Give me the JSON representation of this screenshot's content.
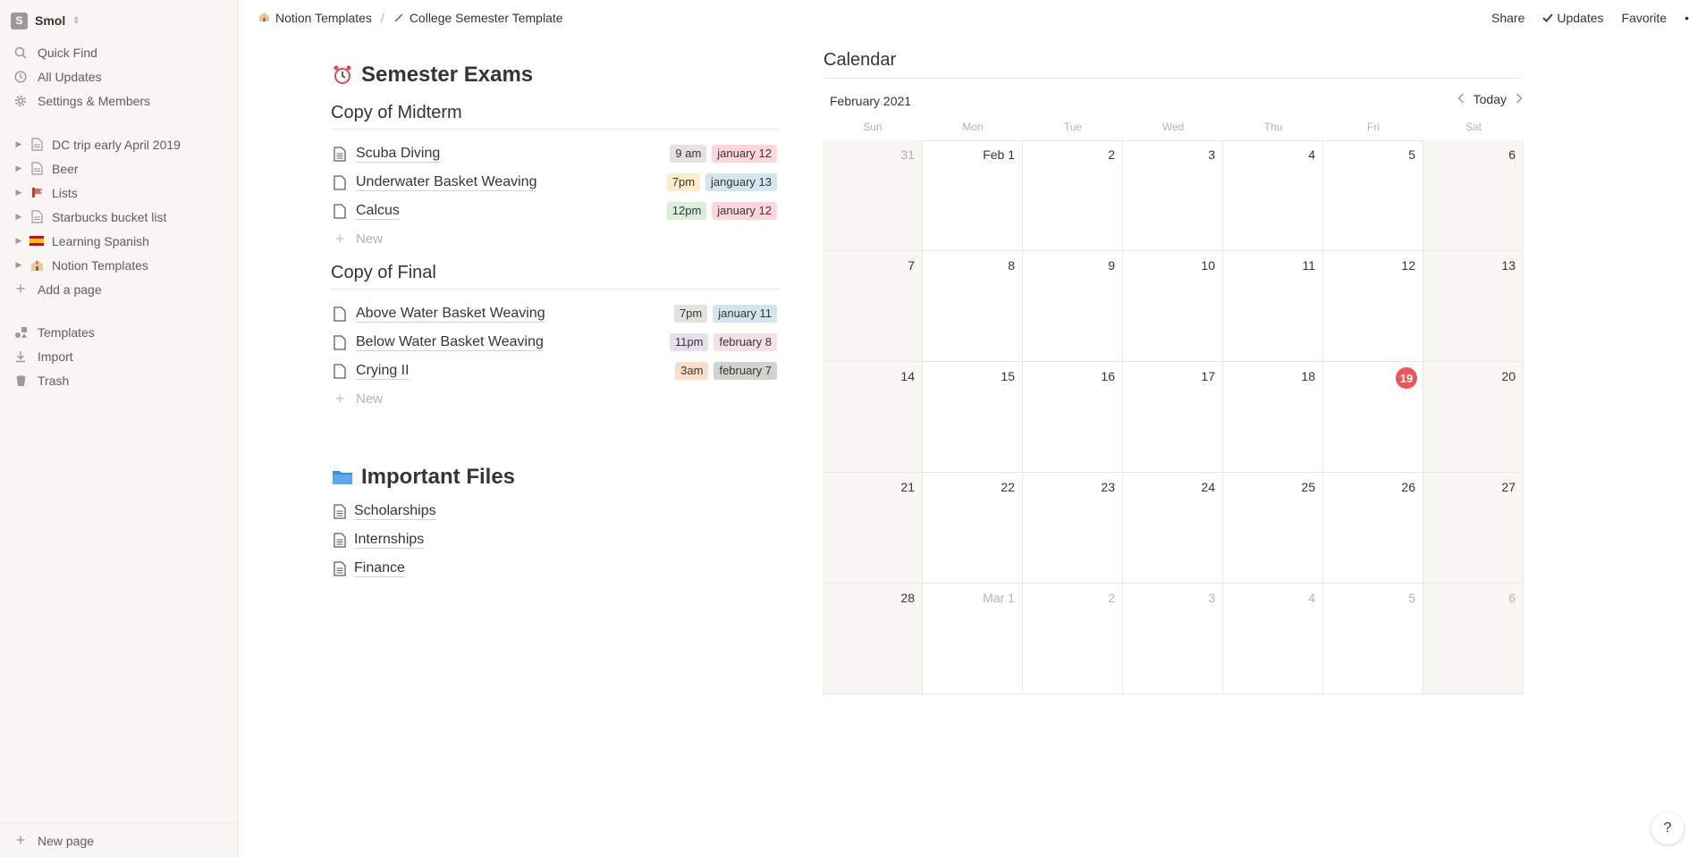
{
  "workspace": {
    "initial": "S",
    "name": "Smol"
  },
  "sidebar": {
    "top": [
      {
        "label": "Quick Find",
        "icon": "search-icon"
      },
      {
        "label": "All Updates",
        "icon": "clock-icon"
      },
      {
        "label": "Settings & Members",
        "icon": "gear-icon"
      }
    ],
    "pages": [
      {
        "label": "DC trip early April 2019",
        "icon": "page-icon"
      },
      {
        "label": "Beer",
        "icon": "page-icon"
      },
      {
        "label": "Lists",
        "icon": "emoji-icon"
      },
      {
        "label": "Starbucks bucket list",
        "icon": "page-icon"
      },
      {
        "label": "Learning Spanish",
        "icon": "spain-flag-icon"
      },
      {
        "label": "Notion Templates",
        "icon": "emoji-icon"
      }
    ],
    "add_page": "Add a page",
    "bottom": [
      {
        "label": "Templates",
        "icon": "shapes-icon"
      },
      {
        "label": "Import",
        "icon": "download-icon"
      },
      {
        "label": "Trash",
        "icon": "trash-icon"
      }
    ],
    "new_page": "New page"
  },
  "topbar": {
    "crumb1": "Notion Templates",
    "crumb_sep": "/",
    "crumb2": "College Semester Template",
    "share": "Share",
    "updates": "Updates",
    "favorite": "Favorite"
  },
  "exams": {
    "title": "Semester Exams",
    "midterm": {
      "title": "Copy of Midterm",
      "rows": [
        {
          "name": "Scuba Diving",
          "time": "9 am",
          "date": "january 12",
          "time_color": "#e3e2e0",
          "date_color": "#ffd6dc"
        },
        {
          "name": "Underwater Basket Weaving",
          "time": "7pm",
          "date": "janguary 13",
          "time_color": "#fdecc8",
          "date_color": "#d3e5ef"
        },
        {
          "name": "Calcus",
          "time": "12pm",
          "date": "january 12",
          "time_color": "#dbeddb",
          "date_color": "#ffd6dc"
        }
      ],
      "new_label": "New"
    },
    "final": {
      "title": "Copy of Final",
      "rows": [
        {
          "name": "Above Water Basket Weaving",
          "time": "7pm",
          "date": "january 11",
          "time_color": "#e3e2e0",
          "date_color": "#d3e5ef"
        },
        {
          "name": "Below Water Basket Weaving",
          "time": "11pm",
          "date": "february 8",
          "time_color": "#e8deee",
          "date_color": "#f5e0e9"
        },
        {
          "name": "Crying II",
          "time": "3am",
          "date": "february 7",
          "time_color": "#fadec9",
          "date_color": "#d3d2ce"
        }
      ],
      "new_label": "New"
    }
  },
  "files": {
    "title": "Important Files",
    "items": [
      "Scholarships",
      "Internships",
      "Finance"
    ]
  },
  "calendar": {
    "title": "Calendar",
    "month": "February 2021",
    "today_label": "Today",
    "weekdays": [
      "Sun",
      "Mon",
      "Tue",
      "Wed",
      "Thu",
      "Fri",
      "Sat"
    ],
    "weeks": [
      [
        "31",
        "Feb 1",
        "2",
        "3",
        "4",
        "5",
        "6"
      ],
      [
        "7",
        "8",
        "9",
        "10",
        "11",
        "12",
        "13"
      ],
      [
        "14",
        "15",
        "16",
        "17",
        "18",
        "19",
        "20"
      ],
      [
        "21",
        "22",
        "23",
        "24",
        "25",
        "26",
        "27"
      ],
      [
        "28",
        "Mar 1",
        "2",
        "3",
        "4",
        "5",
        "6"
      ]
    ],
    "dim_cells": [
      [
        0,
        0
      ],
      [
        4,
        1
      ],
      [
        4,
        2
      ],
      [
        4,
        3
      ],
      [
        4,
        4
      ],
      [
        4,
        5
      ],
      [
        4,
        6
      ]
    ],
    "today_cell": [
      2,
      5
    ],
    "today_color": "#eb5757"
  },
  "help_label": "?"
}
